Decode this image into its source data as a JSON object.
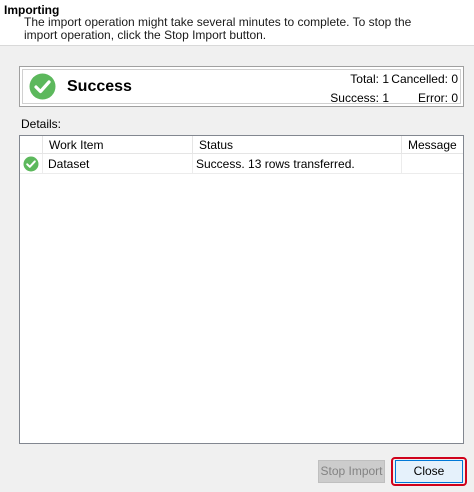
{
  "header": {
    "title": "Importing",
    "description": "The import operation might take several minutes to complete. To stop the import operation, click the Stop Import button."
  },
  "summary": {
    "status": "Success",
    "status_icon": "check-circle-icon",
    "total": "Total: 1",
    "cancelled": "Cancelled: 0",
    "success": "Success: 1",
    "error": "Error: 0"
  },
  "details": {
    "label": "Details:",
    "columns": [
      "",
      "Work Item",
      "Status",
      "Message"
    ],
    "rows": [
      {
        "icon": "check-circle-icon",
        "work_item": "Dataset",
        "status": "Success. 13 rows transferred.",
        "message": ""
      }
    ]
  },
  "buttons": {
    "stop_import": "Stop Import",
    "close": "Close"
  },
  "colors": {
    "success_green": "#5cb85c",
    "highlight_red": "#d0021b",
    "focus_blue": "#0078d7"
  }
}
